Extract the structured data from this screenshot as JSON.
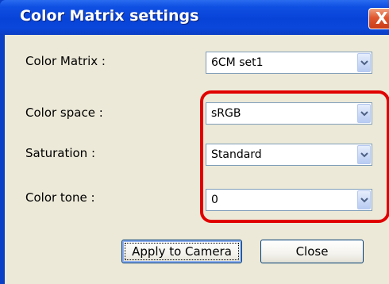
{
  "window": {
    "title": "Color Matrix settings",
    "close_glyph": "X"
  },
  "fields": [
    {
      "label": "Color Matrix :",
      "value": "6CM set1"
    },
    {
      "label": "Color space :",
      "value": "sRGB"
    },
    {
      "label": "Saturation :",
      "value": "Standard"
    },
    {
      "label": "Color tone :",
      "value": "0"
    }
  ],
  "buttons": {
    "apply_label": "Apply to Camera",
    "close_label": "Close"
  },
  "colors": {
    "titlebar": "#0843d8",
    "dialog_bg": "#ece9d8",
    "highlight": "#e00000"
  },
  "icons": {
    "dropdown": "chevron-down-icon",
    "close": "close-icon"
  }
}
